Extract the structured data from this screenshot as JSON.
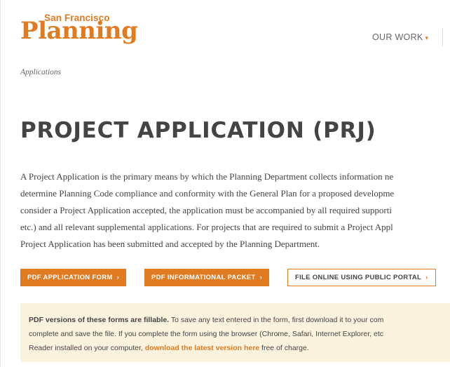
{
  "header": {
    "logo_small": "San Francisco",
    "logo_big": "Planning",
    "nav_our_work": "OUR WORK"
  },
  "breadcrumb": {
    "current": "Applications"
  },
  "title": "PROJECT APPLICATION (PRJ)",
  "paragraph": {
    "lines": [
      "A Project Application is the primary means by which the Planning Department collects information ne",
      "determine Planning Code compliance and conformity with the General Plan for a proposed developme",
      "consider a Project Application accepted, the application must be accompanied by all required supporti",
      "etc.) and all relevant supplemental applications. For projects that are required to submit a Project Appl",
      "Project Application has been submitted and accepted by the Planning Department."
    ]
  },
  "buttons": {
    "pdf_form": "PDF APPLICATION FORM",
    "pdf_packet": "PDF INFORMATIONAL PACKET",
    "file_online": "FILE ONLINE USING PUBLIC PORTAL",
    "chevron": "›"
  },
  "notice": {
    "bold_intro": "PDF versions of these forms are fillable.",
    "line1_rest": " To save any text entered in the form, first download it to your com",
    "line2": "complete and save the file. If you complete the form using the browser (Chrome, Safari, Internet Explorer, etc",
    "line3_pre": "Reader installed on your computer, ",
    "link": "download the latest version here",
    "line3_post": " free of charge."
  },
  "colors": {
    "brand_orange": "#e07b22",
    "notice_bg": "#fcf3de"
  }
}
